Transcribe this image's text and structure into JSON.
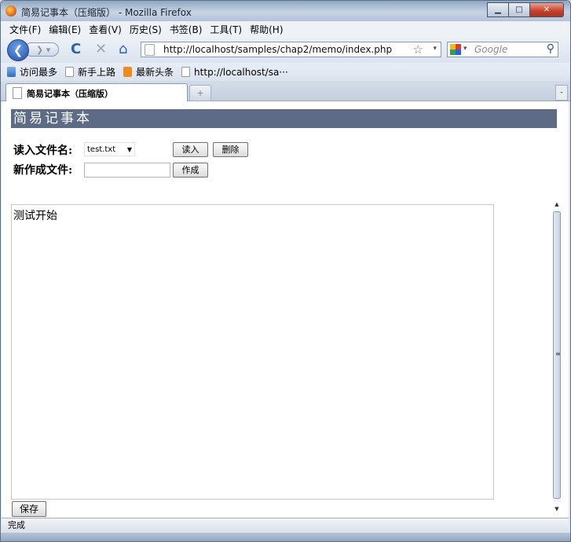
{
  "window": {
    "title": "简易记事本（压缩版） - Mozilla Firefox",
    "minimize_glyph": "▁",
    "maximize_glyph": "□",
    "close_glyph": "✕"
  },
  "menubar": {
    "items": [
      "文件(F)",
      "编辑(E)",
      "查看(V)",
      "历史(S)",
      "书签(B)",
      "工具(T)",
      "帮助(H)"
    ]
  },
  "navbar": {
    "back_glyph": "❮",
    "forward_glyph": "❯ ▾",
    "reload_glyph": "C",
    "stop_glyph": "✕",
    "home_glyph": "⌂",
    "url": "http://localhost/samples/chap2/memo/index.php",
    "star_glyph": "☆",
    "url_dropdown_glyph": "▾",
    "search_dropdown_glyph": "▾",
    "search_placeholder": "Google",
    "search_glyph": "⚲"
  },
  "bookmarks": {
    "items": [
      {
        "label": "访问最多",
        "icon": "visited-icon"
      },
      {
        "label": "新手上路",
        "icon": "page-icon"
      },
      {
        "label": "最新头条",
        "icon": "rss-icon"
      },
      {
        "label": "http://localhost/sa···",
        "icon": "page-icon"
      }
    ]
  },
  "tabs": {
    "active_label": "简易记事本（压缩版）",
    "new_tab_glyph": "+",
    "list_glyph": "-"
  },
  "page": {
    "header": "简易记事本",
    "read_label": "读入文件名:",
    "file_select_value": "test.txt",
    "select_arrow": "▼",
    "read_button": "读入",
    "delete_button": "删除",
    "new_file_label": "新作成文件:",
    "new_file_value": "",
    "create_button": "作成",
    "memo_text": "测试开始",
    "save_button": "保存"
  },
  "scrollbar": {
    "up_glyph": "▲",
    "down_glyph": "▼",
    "grip_glyph": "≡"
  },
  "statusbar": {
    "text": "完成"
  }
}
